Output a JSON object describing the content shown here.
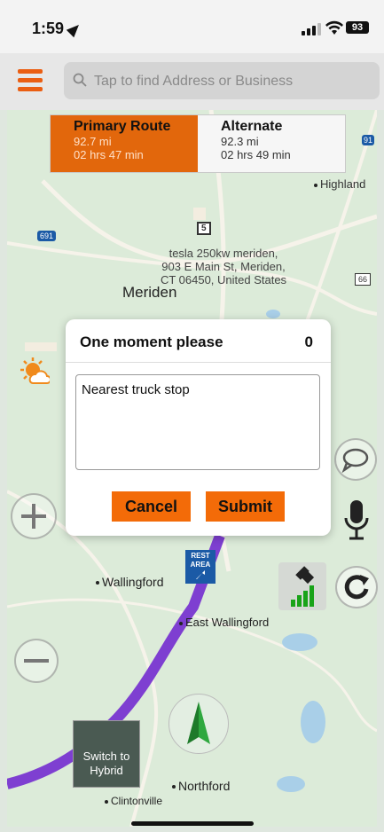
{
  "status": {
    "time": "1:59",
    "battery": "93"
  },
  "search": {
    "placeholder": "Tap to find Address or Business"
  },
  "routes": [
    {
      "name": "Primary Route",
      "distance": "92.7 mi",
      "duration": "02 hrs 47 min"
    },
    {
      "name": "Alternate",
      "distance": "92.3 mi",
      "duration": "02 hrs 49 min"
    }
  ],
  "map": {
    "places": {
      "highland": "Highland",
      "meriden": "Meriden",
      "destination": "tesla 250kw meriden, 903 E Main St, Meriden, CT 06450, United States",
      "wallingford": "Wallingford",
      "east_wallingford": "East Wallingford",
      "northford": "Northford",
      "clintonville": "Clintonville"
    },
    "shields": {
      "i691": "691",
      "us5": "5",
      "i91": "91",
      "route66": "66"
    },
    "rest_area": "REST AREA",
    "hybrid_button": "Switch to Hybrid"
  },
  "dialog": {
    "title": "One moment please",
    "count": "0",
    "text": "Nearest truck stop",
    "cancel": "Cancel",
    "submit": "Submit"
  },
  "icons": {
    "menu": "hamburger-icon",
    "search": "magnifier-icon",
    "chat": "speech-bubble-icon",
    "mic": "microphone-icon",
    "reroute": "reroute-icon",
    "gps": "satellite-signal-icon",
    "compass": "compass-arrow-icon",
    "weather": "weather-sun-cloud-icon"
  },
  "colors": {
    "accent": "#f36b08",
    "route_line": "#7e3fd1"
  }
}
